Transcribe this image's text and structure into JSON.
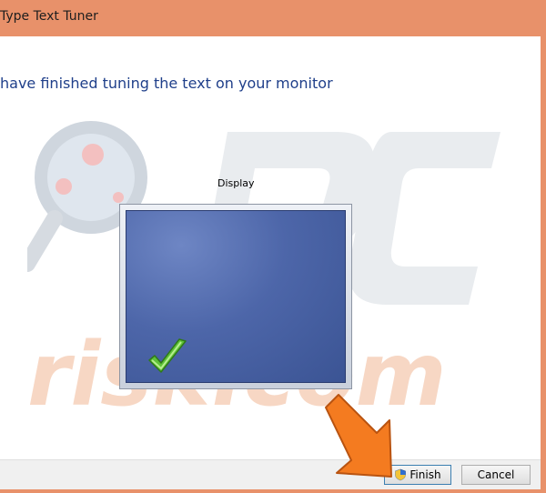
{
  "window": {
    "title": "Type Text Tuner",
    "frame_color": "#e8916a"
  },
  "main": {
    "heading": "have finished tuning the text on your monitor",
    "display_label": "Display",
    "heading_color": "#1f3f8a"
  },
  "buttons": {
    "finish_label": "Finish",
    "cancel_label": "Cancel"
  },
  "watermark": {
    "text": "risk.com",
    "logo_letters": "PC"
  },
  "icons": {
    "check": "checkmark-icon",
    "shield": "uac-shield-icon",
    "arrow": "pointer-arrow"
  }
}
